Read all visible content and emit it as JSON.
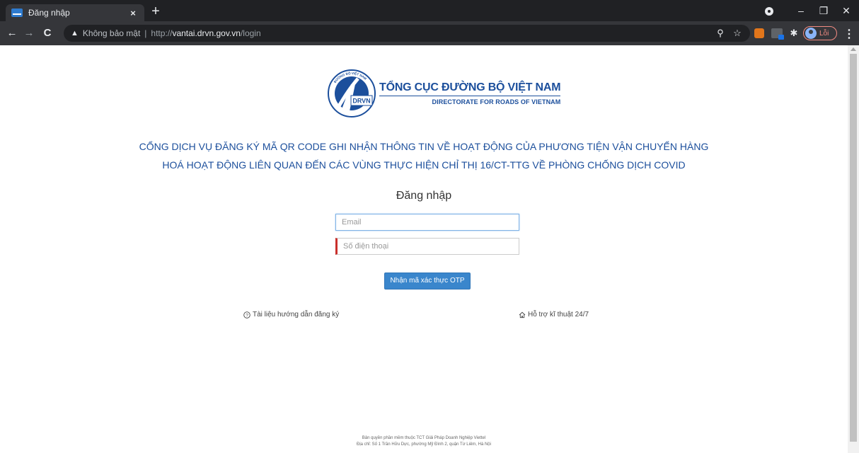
{
  "browser": {
    "tab_title": "Đăng nhập",
    "tab_close": "×",
    "new_tab": "+",
    "omnibox": {
      "security_label": "Không bảo mật",
      "separator": "|",
      "url_scheme": "http://",
      "url_host": "vantai.drvn.gov.vn",
      "url_path": "/login"
    },
    "profile_error_label": "Lỗi",
    "window_controls": [
      "–",
      "❐",
      "✕"
    ]
  },
  "header": {
    "logo_org_vn": "TỔNG CỤC ĐƯỜNG BỘ VIỆT NAM",
    "logo_org_en": "DIRECTORATE FOR ROADS OF VIETNAM",
    "logo_badge": "DRVN",
    "logo_ring_text": "ĐƯỜNG BỘ VIỆT NAM"
  },
  "portal": {
    "title_line1": "CỔNG DỊCH VỤ ĐĂNG KÝ MÃ QR CODE GHI NHẬN THÔNG TIN VỀ HOẠT ĐỘNG CỦA PHƯƠNG TIỆN VẬN CHUYỂN HÀNG",
    "title_line2": "HOÁ HOẠT ĐỘNG LIÊN QUAN ĐẾN CÁC VÙNG THỰC HIỆN CHỈ THỊ 16/CT-TTG VỀ PHÒNG CHỐNG DỊCH COVID"
  },
  "login": {
    "heading": "Đăng nhập",
    "email_placeholder": "Email",
    "phone_placeholder": "Số điện thoại",
    "otp_button": "Nhận mã xác thực OTP"
  },
  "links": {
    "guide": "Tài liệu hướng dẫn đăng ký",
    "support": "Hỗ trợ kĩ thuật 24/7"
  },
  "footer": {
    "line1": "Bản quyền phần mềm thuộc TCT Giải Pháp Doanh Nghiệp Viettel",
    "line2": "Địa chỉ: Số 1 Trần Hữu Dực, phường Mỹ Đình 2, quận Từ Liêm, Hà Nội"
  },
  "colors": {
    "brand_blue": "#1c4f9c",
    "button_blue": "#3a86cc",
    "required_red": "#c9302c"
  }
}
